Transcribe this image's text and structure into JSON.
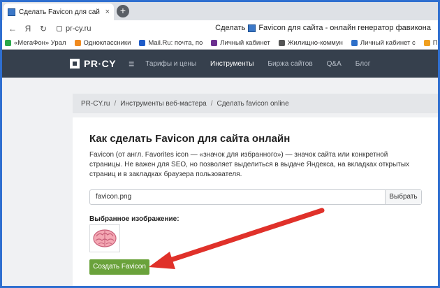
{
  "browser": {
    "tab_title": "Сделать Favicon для сай",
    "tab_close": "×",
    "newtab": "+",
    "back": "←",
    "forward": "Я",
    "reload": "↻",
    "url": "pr-cy.ru",
    "page_title_prefix": "Сделать",
    "page_title": "Favicon для сайта - онлайн генератор фавикона"
  },
  "bookmarks": [
    {
      "label": "«МегаФон» Урал",
      "color": "#2aa84a"
    },
    {
      "label": "Одноклассники",
      "color": "#f08a1f"
    },
    {
      "label": "Mail.Ru: почта, по",
      "color": "#1d5bc8"
    },
    {
      "label": "Личный кабинет",
      "color": "#6b2f8f"
    },
    {
      "label": "Жилищно-коммун",
      "color": "#555555"
    },
    {
      "label": "Личный кабинет с",
      "color": "#2d6fc9"
    },
    {
      "label": "Погода в",
      "color": "#f0a020"
    }
  ],
  "site": {
    "logo": "PR·CY",
    "menu_icon": "≡",
    "nav": [
      "Тарифы и цены",
      "Инструменты",
      "Биржа сайтов",
      "Q&A",
      "Блог"
    ],
    "nav_active_index": 1
  },
  "breadcrumb": {
    "items": [
      "PR-CY.ru",
      "Инструменты веб-мастера",
      "Сделать favicon online"
    ],
    "sep": "/"
  },
  "main": {
    "heading": "Как сделать Favicon для сайта онлайн",
    "description": "Favicon (от англ. Favorites icon — «значок для избранного») — значок сайта или конкретной страницы. Не важен для SEO, но позволяет выделиться в выдаче Яндекса, на вкладках открытых страниц и в закладках браузера пользователя.",
    "file_value": "favicon.png",
    "browse_label": "Выбрать",
    "selected_label": "Выбранное изображение:",
    "create_label": "Создать Favicon"
  },
  "colors": {
    "frame": "#2f6fd0",
    "header_bg": "#36404d",
    "accent_green": "#6aa23b",
    "arrow_red": "#e0312a"
  }
}
